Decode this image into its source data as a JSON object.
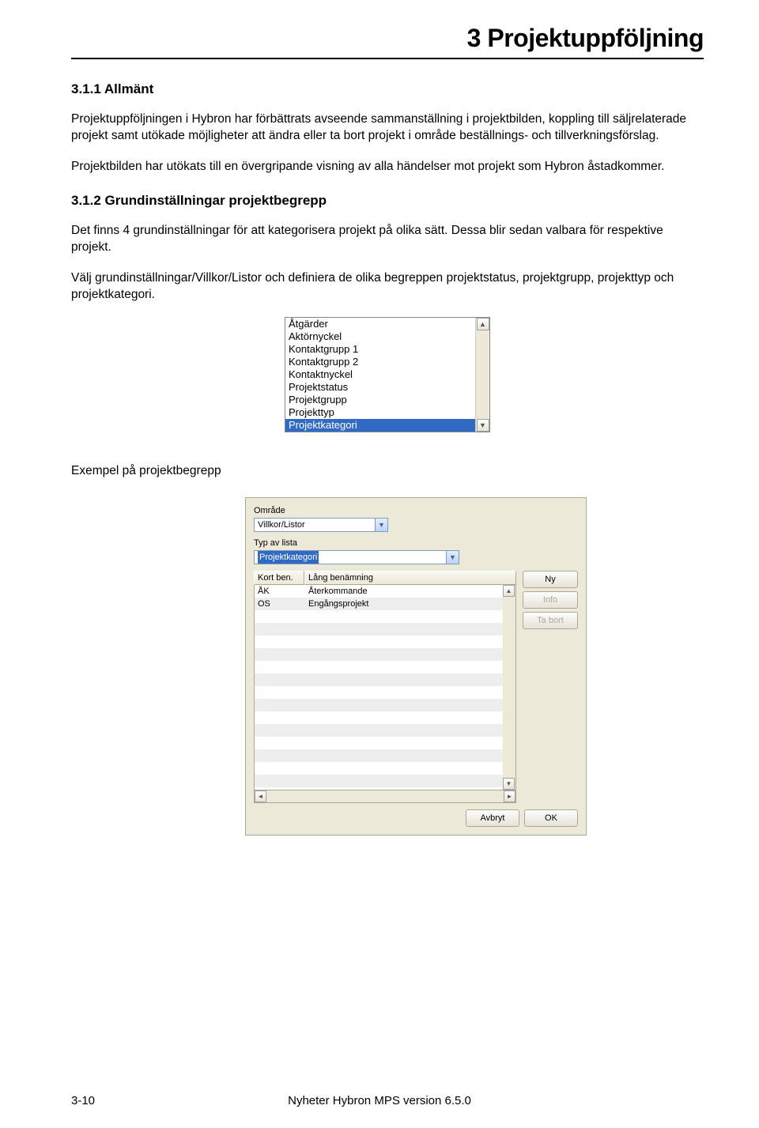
{
  "chapter": {
    "title": "3 Projektuppföljning"
  },
  "section311": {
    "heading": "3.1.1  Allmänt",
    "p1": "Projektuppföljningen i Hybron har förbättrats avseende sammanställning i projektbilden, koppling till säljrelaterade projekt samt utökade möjligheter att ändra eller ta bort projekt i område beställnings- och tillverkningsförslag.",
    "p2": "Projektbilden har utökats till en övergripande visning av alla händelser mot projekt som Hybron åstadkommer."
  },
  "section312": {
    "heading": "3.1.2  Grundinställningar projektbegrepp",
    "p1": "Det finns 4 grundinställningar för att kategorisera projekt på olika sätt. Dessa blir sedan valbara för respektive projekt.",
    "p2": "Välj grundinställningar/Villkor/Listor och definiera de olika begreppen projektstatus, projektgrupp, projekttyp och projektkategori."
  },
  "listbox": {
    "items": [
      "Åtgärder",
      "Aktörnyckel",
      "Kontaktgrupp 1",
      "Kontaktgrupp 2",
      "Kontaktnyckel",
      "Projektstatus",
      "Projektgrupp",
      "Projekttyp",
      "Projektkategori"
    ],
    "selectedIndex": 8
  },
  "example_label": "Exempel på projektbegrepp",
  "dialog": {
    "field_omrade_label": "Område",
    "field_omrade_value": "Villkor/Listor",
    "field_typ_label": "Typ av lista",
    "field_typ_value": "Projektkategori",
    "col1": "Kort ben.",
    "col2": "Lång benämning",
    "rows": [
      {
        "kort": "ÅK",
        "lang": "Återkommande"
      },
      {
        "kort": "OS",
        "lang": "Engångsprojekt"
      }
    ],
    "btn_ny": "Ny",
    "btn_info": "Info",
    "btn_tabort": "Ta bort",
    "btn_avbryt": "Avbryt",
    "btn_ok": "OK"
  },
  "footer": {
    "page": "3-10",
    "center": "Nyheter Hybron MPS version 6.5.0"
  }
}
